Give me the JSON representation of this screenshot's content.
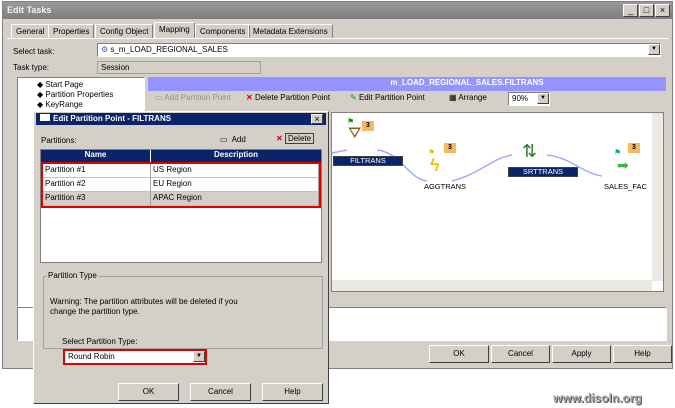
{
  "window": {
    "title": "Edit Tasks",
    "controls": [
      "_",
      "□",
      "×"
    ]
  },
  "tabs": [
    "General",
    "Properties",
    "Config Object",
    "Mapping",
    "Components",
    "Metadata Extensions"
  ],
  "active_tab": "Mapping",
  "select_task": {
    "label": "Select task:",
    "value": "s_m_LOAD_REGIONAL_SALES"
  },
  "task_type": {
    "label": "Task type:",
    "value": "Session"
  },
  "tree": [
    "Start Page",
    "Partition Properties",
    "KeyRange"
  ],
  "mapping": {
    "header": "m_LOAD_REGIONAL_SALES.FILTRANS",
    "toolbar": {
      "add": "Add Partition Point",
      "delete": "Delete Partition Point",
      "edit": "Edit Partition Point",
      "arrange": "Arrange",
      "zoom": "90%"
    },
    "nodes": [
      {
        "name": "FILTRANS",
        "partitions": "3"
      },
      {
        "name": "AGGTRANS",
        "partitions": "3"
      },
      {
        "name": "SRTTRANS",
        "partitions": ""
      },
      {
        "name": "SALES_FAC",
        "partitions": "3"
      }
    ]
  },
  "buttons": {
    "ok": "OK",
    "cancel": "Cancel",
    "apply": "Apply",
    "help": "Help"
  },
  "dialog": {
    "title": "Edit Partition Point - FILTRANS",
    "partitions_label": "Partitions:",
    "add": "Add",
    "delete": "Delete",
    "columns": [
      "Name",
      "Description"
    ],
    "rows": [
      [
        "Partition #1",
        "US Region"
      ],
      [
        "Partition #2",
        "EU Region"
      ],
      [
        "Partition #3",
        "APAC Region"
      ]
    ],
    "group_label": "Partition Type",
    "warning": "Warning: The partition attributes will be deleted if you change the partition type.",
    "select_label": "Select Partition Type:",
    "select_value": "Round Robin",
    "ok": "OK",
    "cancel": "Cancel",
    "help": "Help"
  },
  "watermark": "www.disoln.org",
  "colors": {
    "navy": "#0a246a",
    "header_bar": "#9494ff",
    "highlight": "#e00000"
  }
}
